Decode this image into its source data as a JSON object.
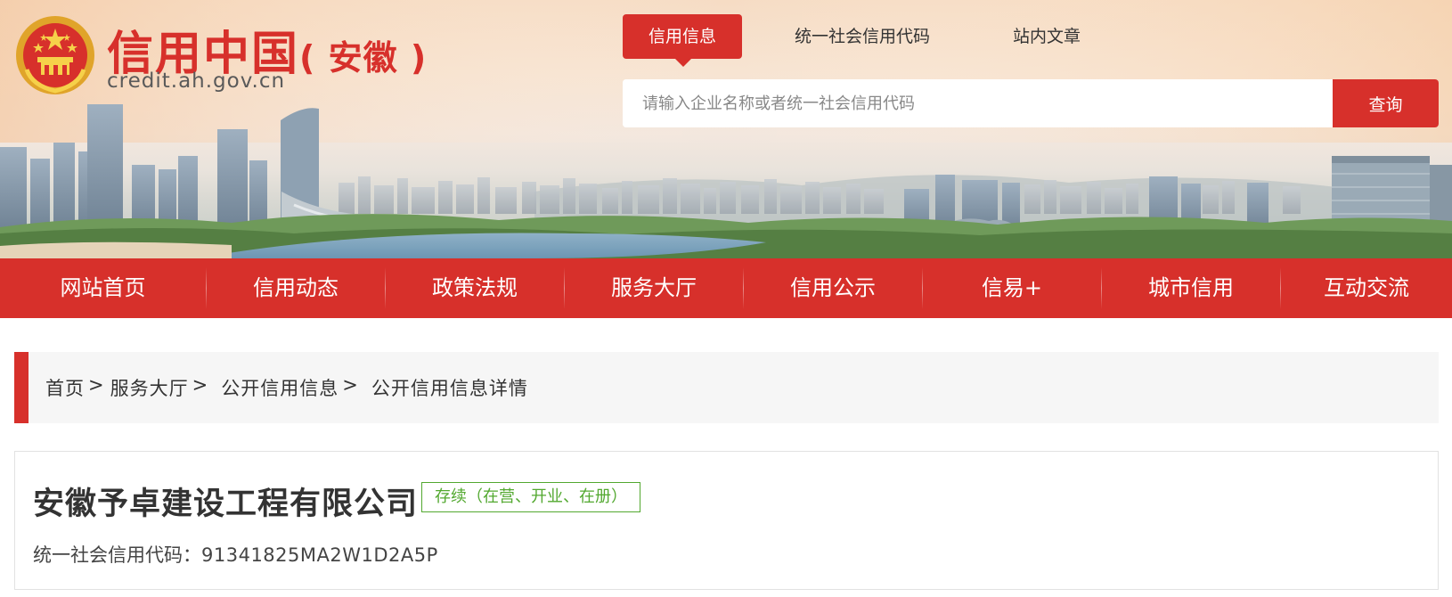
{
  "header": {
    "site_title": "信用中国",
    "site_region": "( 安徽 )",
    "site_domain": "credit.ah.gov.cn",
    "logo": "national-emblem"
  },
  "search": {
    "tabs": [
      {
        "label": "信用信息",
        "active": true
      },
      {
        "label": "统一社会信用代码",
        "active": false
      },
      {
        "label": "站内文章",
        "active": false
      }
    ],
    "placeholder": "请输入企业名称或者统一社会信用代码",
    "value": "",
    "button_label": "查询"
  },
  "nav": {
    "items": [
      {
        "label": "网站首页"
      },
      {
        "label": "信用动态"
      },
      {
        "label": "政策法规"
      },
      {
        "label": "服务大厅"
      },
      {
        "label": "信用公示"
      },
      {
        "label": "信易+"
      },
      {
        "label": "城市信用"
      },
      {
        "label": "互动交流"
      }
    ]
  },
  "breadcrumb": {
    "items": [
      "首页",
      "服务大厅",
      "公开信用信息",
      "公开信用信息详情"
    ],
    "separator": ">"
  },
  "company": {
    "name": "安徽予卓建设工程有限公司",
    "status": "存续（在营、开业、在册）",
    "uscc_label": "统一社会信用代码：",
    "uscc_value": "91341825MA2W1D2A5P"
  },
  "colors": {
    "primary_red": "#d7302b",
    "status_green": "#52a82f",
    "breadcrumb_bg": "#f6f6f6",
    "text": "#333333"
  }
}
